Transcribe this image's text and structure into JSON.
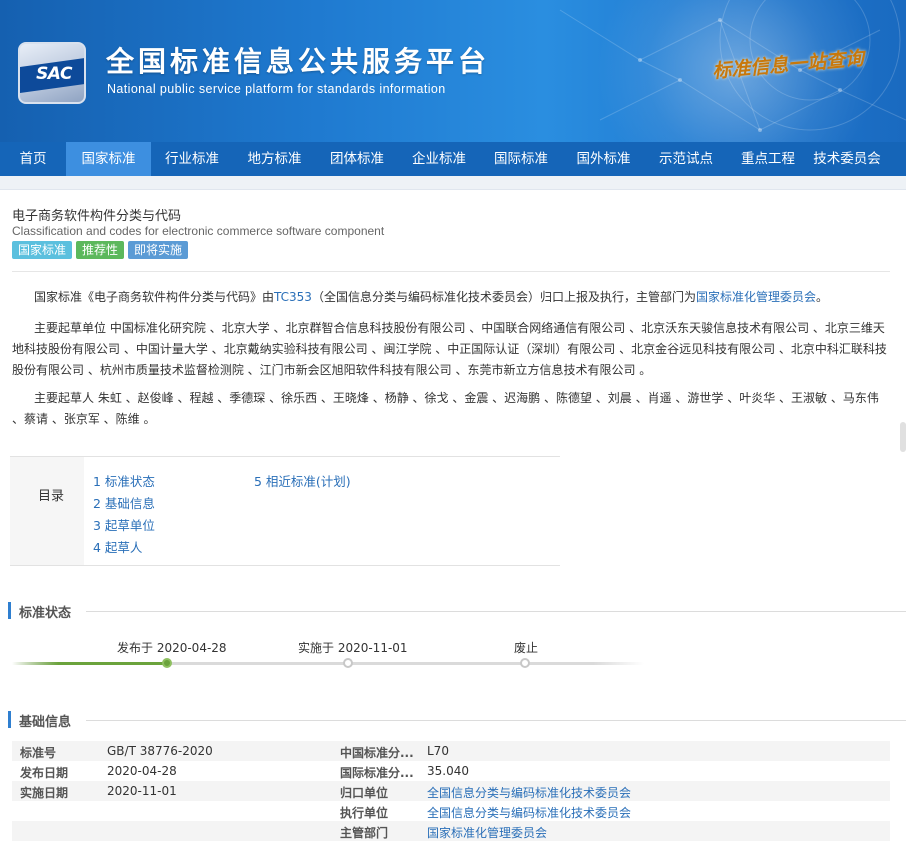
{
  "header": {
    "logo_text": "SAC",
    "title_cn": "全国标准信息公共服务平台",
    "title_en": "National public service platform  for standards information",
    "slogan": "标准信息一站查询"
  },
  "nav": {
    "items": [
      "首页",
      "国家标准",
      "行业标准",
      "地方标准",
      "团体标准",
      "企业标准",
      "国际标准",
      "国外标准",
      "示范试点",
      "重点工程",
      "技术委员会"
    ],
    "active_index": 1
  },
  "standard": {
    "title_cn": "电子商务软件构件分类与代码",
    "title_en": "Classification and codes for electronic commerce software component",
    "badges": [
      {
        "label": "国家标准",
        "color": "#5bc0de"
      },
      {
        "label": "推荐性",
        "color": "#5cb85c"
      },
      {
        "label": "即将实施",
        "color": "#5b9bd5"
      }
    ]
  },
  "summary": {
    "p1_prefix": "国家标准《电子商务软件构件分类与代码》由",
    "p1_tc": "TC353",
    "p1_middle": "（全国信息分类与编码标准化技术委员会）归口上报及执行，主管部门为",
    "p1_dept": "国家标准化管理委员会",
    "p1_suffix": "。",
    "p2": "主要起草单位 中国标准化研究院 、北京大学 、北京群智合信息科技股份有限公司 、中国联合网络通信有限公司 、北京沃东天骏信息技术有限公司 、北京三维天地科技股份有限公司 、中国计量大学 、北京戴纳实验科技有限公司 、闽江学院 、中正国际认证（深圳）有限公司 、北京金谷远见科技有限公司 、北京中科汇联科技股份有限公司 、杭州市质量技术监督检测院 、江门市新会区旭阳软件科技有限公司 、东莞市新立方信息技术有限公司 。",
    "p3": "主要起草人 朱虹 、赵俊峰 、程越 、季德琛 、徐乐西 、王晓烽 、杨静 、徐戈 、金震 、迟海鹏 、陈德望 、刘晨 、肖遥 、游世学 、叶炎华 、王淑敏 、马东伟 、蔡请 、张京军 、陈维 。"
  },
  "toc": {
    "label": "目录",
    "items": [
      "1  标准状态",
      "2  基础信息",
      "3  起草单位",
      "4  起草人",
      "5  相近标准(计划)"
    ]
  },
  "status": {
    "section_title": "标准状态",
    "milestones": [
      {
        "label": "发布于 2020-04-28",
        "done": true
      },
      {
        "label": "实施于 2020-11-01",
        "done": false
      },
      {
        "label": "废止",
        "done": false
      }
    ]
  },
  "basic": {
    "section_title": "基础信息",
    "left": [
      {
        "key": "标准号",
        "value": "GB/T 38776-2020"
      },
      {
        "key": "发布日期",
        "value": "2020-04-28"
      },
      {
        "key": "实施日期",
        "value": "2020-11-01"
      }
    ],
    "right": [
      {
        "key": "中国标准分...",
        "value": "L70",
        "link": false
      },
      {
        "key": "国际标准分...",
        "value": "35.040",
        "link": false
      },
      {
        "key": "归口单位",
        "value": "全国信息分类与编码标准化技术委员会",
        "link": true
      },
      {
        "key": "执行单位",
        "value": "全国信息分类与编码标准化技术委员会",
        "link": true
      },
      {
        "key": "主管部门",
        "value": "国家标准化管理委员会",
        "link": true
      }
    ]
  }
}
